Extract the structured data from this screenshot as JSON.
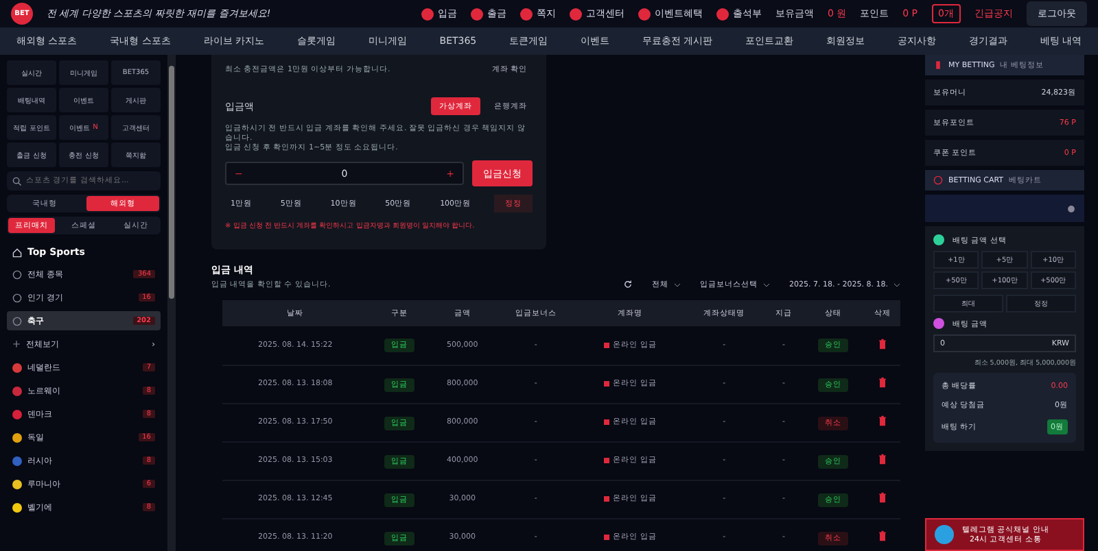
{
  "header": {
    "logo": "BET",
    "tagline": "전 세계 다양한 스포츠의 짜릿한 재미를 즐겨보세요!",
    "links": [
      {
        "label": "입금"
      },
      {
        "label": "출금"
      },
      {
        "label": "쪽지"
      },
      {
        "label": "고객센터"
      },
      {
        "label": "이벤트혜택"
      },
      {
        "label": "출석부"
      }
    ],
    "balance_label": "보유금액",
    "balance": "0 원",
    "point_label": "포인트",
    "point": "0 P",
    "coupon": "0개",
    "notice": "긴급공지",
    "logout": "로그아웃"
  },
  "nav": [
    "해외형 스포츠",
    "국내형 스포츠",
    "라이브 카지노",
    "슬롯게임",
    "미니게임",
    "BET365",
    "토큰게임",
    "이벤트",
    "무료충전 게시판",
    "포인트교환",
    "회원정보",
    "공지사항",
    "경기결과",
    "베팅 내역"
  ],
  "sidebar": {
    "shortcuts": [
      {
        "label": "실시간"
      },
      {
        "label": "미니게임"
      },
      {
        "label": "BET365"
      },
      {
        "label": "배팅내역"
      },
      {
        "label": "이벤트"
      },
      {
        "label": "게시판"
      },
      {
        "label": "적립 포인트"
      },
      {
        "label": "이벤트",
        "badge": "N"
      },
      {
        "label": "고객센터"
      },
      {
        "label": "출금 신청"
      },
      {
        "label": "충전 신청"
      },
      {
        "label": "쪽지함"
      }
    ],
    "search": {
      "placeholder": "스포츠 경기를 검색하세요..."
    },
    "modes": [
      {
        "label": "국내형",
        "selected": false
      },
      {
        "label": "해외형",
        "selected": true
      }
    ],
    "tabs": [
      {
        "label": "프리매치",
        "selected": true
      },
      {
        "label": "스페셜",
        "selected": false
      },
      {
        "label": "실시간",
        "selected": false
      }
    ],
    "section_title": "Top Sports",
    "items": [
      {
        "kind": "category",
        "label": "전체 종목",
        "count": "364",
        "selected": false
      },
      {
        "kind": "category",
        "label": "인기 경기",
        "count": "16",
        "selected": false
      },
      {
        "kind": "category",
        "label": "축구",
        "count": "202",
        "selected": true
      },
      {
        "kind": "all",
        "label": "전체보기",
        "count": "›",
        "selected": false
      },
      {
        "kind": "country",
        "label": "네덜란드",
        "count": "7",
        "color": "#d63a3a",
        "selected": false
      },
      {
        "kind": "country",
        "label": "노르웨이",
        "count": "8",
        "color": "#c8283c",
        "selected": false
      },
      {
        "kind": "country",
        "label": "덴마크",
        "count": "8",
        "color": "#d8203a",
        "selected": false
      },
      {
        "kind": "country",
        "label": "독일",
        "count": "16",
        "color": "#e0a010",
        "selected": false
      },
      {
        "kind": "country",
        "label": "러시아",
        "count": "8",
        "color": "#3060c0",
        "selected": false
      },
      {
        "kind": "country",
        "label": "루마니아",
        "count": "6",
        "color": "#e8c020",
        "selected": false
      },
      {
        "kind": "country",
        "label": "벨기에",
        "count": "8",
        "color": "#f0c810",
        "selected": false
      }
    ]
  },
  "deposit": {
    "subtitle": "최소 충전금액은 1만원 이상부터 가능합니다.",
    "account_button": "계좌 확인",
    "amount_label": "입금액",
    "methods": [
      {
        "label": "가상계좌",
        "selected": true
      },
      {
        "label": "은행계좌",
        "selected": false
      }
    ],
    "notice": "입금하시기 전 반드시 입금 계좌를 확인해 주세요. 잘못 입금하신 경우 책임지지 않습니다.\n입금 신청 후 확인까지 1~5분 정도 소요됩니다.",
    "minus": "−",
    "amount": "0",
    "plus": "+",
    "submit": "입금신청",
    "quick": [
      "1만원",
      "5만원",
      "10만원",
      "50만원",
      "100만원"
    ],
    "reset": "정정",
    "warning": "※ 입금 신청 전 반드시 계좌를 확인하시고 입금자명과 회원명이 일치해야 합니다."
  },
  "history": {
    "title": "입금 내역",
    "subtitle": "입금 내역을 확인할 수 있습니다.",
    "filters": [
      "전체",
      "입금보너스선택",
      "2025. 7. 18. - 2025. 8. 18."
    ],
    "columns": [
      "날짜",
      "구분",
      "금액",
      "입금보너스",
      "계좌명",
      "계좌상태명",
      "지급",
      "상태",
      "삭제"
    ],
    "rows": [
      {
        "date": "2025. 08. 14. 15:22",
        "type": "입금",
        "amount": "500,000",
        "bonus": "-",
        "account": "온라인 입금",
        "account_status": "-",
        "paid": "-",
        "status": "승인",
        "approved": true
      },
      {
        "date": "2025. 08. 13. 18:08",
        "type": "입금",
        "amount": "800,000",
        "bonus": "-",
        "account": "온라인 입금",
        "account_status": "-",
        "paid": "-",
        "status": "승인",
        "approved": true
      },
      {
        "date": "2025. 08. 13. 17:50",
        "type": "입금",
        "amount": "800,000",
        "bonus": "-",
        "account": "온라인 입금",
        "account_status": "-",
        "paid": "-",
        "status": "취소",
        "approved": false
      },
      {
        "date": "2025. 08. 13. 15:03",
        "type": "입금",
        "amount": "400,000",
        "bonus": "-",
        "account": "온라인 입금",
        "account_status": "-",
        "paid": "-",
        "status": "승인",
        "approved": true
      },
      {
        "date": "2025. 08. 13. 12:45",
        "type": "입금",
        "amount": "30,000",
        "bonus": "-",
        "account": "온라인 입금",
        "account_status": "-",
        "paid": "-",
        "status": "승인",
        "approved": true
      },
      {
        "date": "2025. 08. 13. 11:20",
        "type": "입금",
        "amount": "30,000",
        "bonus": "-",
        "account": "온라인 입금",
        "account_status": "-",
        "paid": "-",
        "status": "취소",
        "approved": false
      }
    ]
  },
  "right": {
    "my_title": "MY BETTING",
    "my_sub": "내 베팅정보",
    "stats": [
      {
        "label": "보유머니",
        "value": "24,823원",
        "accent": false
      },
      {
        "label": "보유포인트",
        "value": "76 P",
        "accent": true
      },
      {
        "label": "쿠폰 포인트",
        "value": "0 P",
        "accent": true
      }
    ],
    "cart_title": "BETTING CART",
    "cart_sub": "베팅카트",
    "amount_title": "배팅 금액 선택",
    "chips": [
      "+1만",
      "+5만",
      "+10만",
      "+50만",
      "+100만",
      "+500만"
    ],
    "wide_chips": [
      "최대",
      "정정"
    ],
    "input_title": "배팅 금액",
    "input_value": "0",
    "input_unit": "KRW",
    "limits": "최소 5,000원, 최대 5,000,000원",
    "summary": [
      {
        "label": "총 배당률",
        "value": "0.00",
        "kind": "red"
      },
      {
        "label": "예상 당첨금",
        "value": "0원",
        "kind": "plain"
      },
      {
        "label": "배팅 하기",
        "value": "0원",
        "kind": "green"
      }
    ],
    "banner": "텔레그램 공식채널 안내\n24시 고객센터 소통"
  }
}
